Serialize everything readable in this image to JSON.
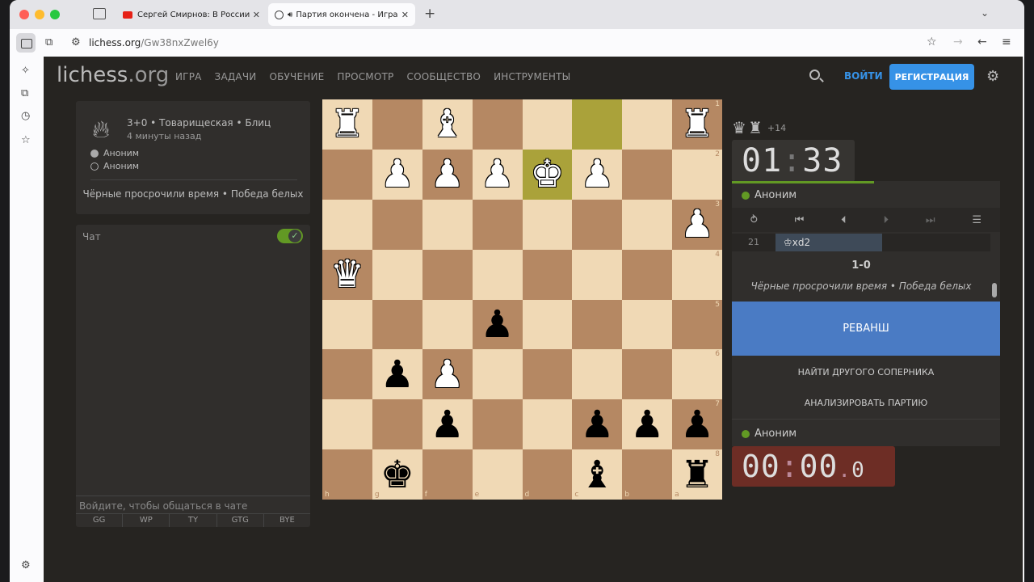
{
  "browser": {
    "tabs": [
      {
        "title": "Сергей Смирнов: В России бо"
      },
      {
        "title": "Партия окончена - Игра Ан"
      }
    ],
    "url_host": "lichess.org",
    "url_path": "/Gw38nxZwel6y",
    "colors": {
      "youtube": "#e62117"
    }
  },
  "site": {
    "logo_main": "lichess",
    "logo_tld": ".org",
    "nav": [
      "ИГРА",
      "ЗАДАЧИ",
      "ОБУЧЕНИЕ",
      "ПРОСМОТР",
      "СООБЩЕСТВО",
      "ИНСТРУМЕНТЫ"
    ],
    "login": "ВОЙТИ",
    "register": "РЕГИСТРАЦИЯ",
    "colors": {
      "accent": "#3692e7",
      "online": "#629924"
    }
  },
  "game_info": {
    "title": "3+0 • Товарищеская • Блиц",
    "time_ago": "4 минуты назад",
    "white_player": "Аноним",
    "black_player": "Аноним",
    "result": "Чёрные просрочили время • Победа белых"
  },
  "chat": {
    "title": "Чат",
    "input_placeholder": "Войдите, чтобы общаться в чате",
    "presets": [
      "GG",
      "WP",
      "TY",
      "GTG",
      "BYE"
    ]
  },
  "board": {
    "orientation": "black",
    "ranks": [
      [
        "wR",
        "",
        "wB",
        "",
        "",
        "",
        "",
        "wR"
      ],
      [
        "",
        "wP",
        "wP",
        "wP",
        "wK",
        "wP",
        "",
        ""
      ],
      [
        "",
        "",
        "",
        "",
        "",
        "",
        "",
        "wP"
      ],
      [
        "wQ",
        "",
        "",
        "",
        "",
        "",
        "",
        ""
      ],
      [
        "",
        "",
        "",
        "bP",
        "",
        "",
        "",
        ""
      ],
      [
        "",
        "bP",
        "wP",
        "",
        "",
        "",
        "",
        ""
      ],
      [
        "",
        "",
        "bP",
        "",
        "",
        "bP",
        "bP",
        "bP"
      ],
      [
        "",
        "bK",
        "",
        "",
        "",
        "bB",
        "",
        "bR"
      ]
    ],
    "rank_labels": [
      "1",
      "2",
      "3",
      "4",
      "5",
      "6",
      "7",
      "8"
    ],
    "file_labels": [
      "h",
      "g",
      "f",
      "e",
      "d",
      "c",
      "b",
      "a"
    ],
    "highlights": [
      [
        0,
        5
      ],
      [
        1,
        4
      ]
    ]
  },
  "right_panel": {
    "material_adv": "+14",
    "top_clock": {
      "min": "01",
      "sec": "33"
    },
    "top_player": "Аноним",
    "move_number": "21",
    "move": "♔xd2",
    "score": "1-0",
    "status": "Чёрные просрочили время • Победа белых",
    "rematch": "РЕВАНШ",
    "find_opponent": "НАЙТИ ДРУГОГО СОПЕРНИКА",
    "analyze": "АНАЛИЗИРОВАТЬ ПАРТИЮ",
    "bottom_player": "Аноним",
    "bottom_clock": {
      "min": "00",
      "sec": "00",
      "tenths": "0"
    },
    "top_clock_remaining_fraction": 0.53
  }
}
